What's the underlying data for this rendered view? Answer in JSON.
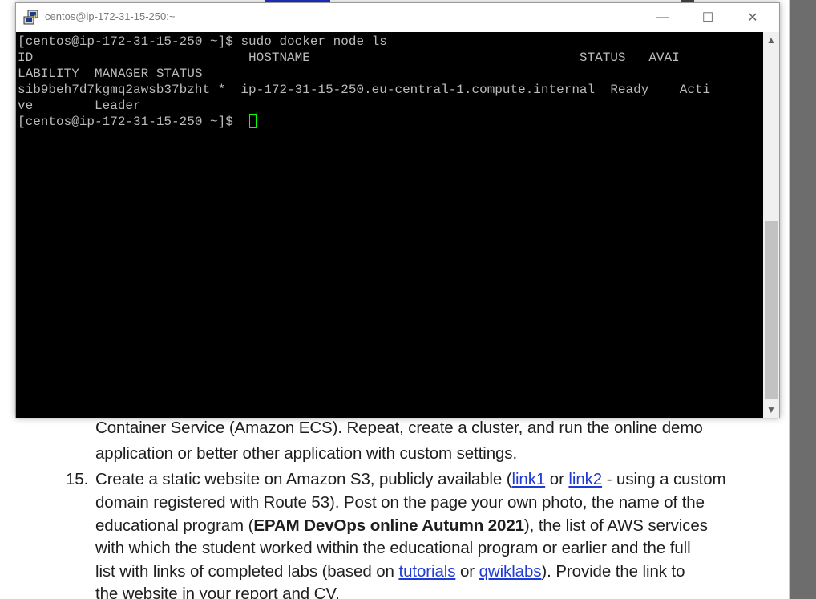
{
  "window": {
    "title": "centos@ip-172-31-15-250:~",
    "minimize": "—",
    "maximize": "☐",
    "close": "✕"
  },
  "terminal": {
    "lines": [
      "[centos@ip-172-31-15-250 ~]$ sudo docker node ls",
      "ID                            HOSTNAME                                   STATUS   AVAI",
      "LABILITY  MANAGER STATUS",
      "sib9beh7d7kgmq2awsb37bzht *  ip-172-31-15-250.eu-central-1.compute.internal  Ready    Acti",
      "ve        Leader",
      "[centos@ip-172-31-15-250 ~]$ "
    ],
    "cursor_color": "#00ff00"
  },
  "scrollbar": {
    "up": "▲",
    "down": "▼"
  },
  "document": {
    "line1": "Container Service (Amazon ECS). Repeat, create a cluster, and run the online demo",
    "line2": "application or better other application with custom settings.",
    "item_number": "15.",
    "line3_pre": "Create a static website on Amazon S3, publicly available (",
    "link1": "link1",
    "line3_or": " or ",
    "link2": "link2",
    "line3_post": " - using a custom",
    "line4": "domain registered with Route 53). Post on the page your own photo, the name of the",
    "line5_pre": "educational program (",
    "line5_bold": "EPAM DevOps online Autumn 2021",
    "line5_post": "), the list of AWS services",
    "line6": "with which the student worked within the educational program or earlier and the full",
    "line7_pre": "list with links of completed labs (based on ",
    "tutorials": "tutorials",
    "line7_or": " or ",
    "qwiklabs": "qwiklabs",
    "line7_post": "). Provide the link to",
    "line8": "the website in your report and CV."
  },
  "colors": {
    "terminal_bg": "#000000",
    "terminal_fg": "#bbbbbb",
    "link": "#1f3bd6"
  }
}
